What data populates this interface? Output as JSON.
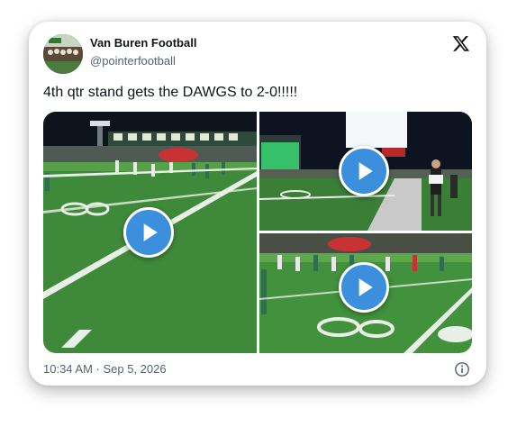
{
  "author": {
    "display_name": "Van Buren Football",
    "handle": "@pointerfootball",
    "avatar_icon": "team-photo-avatar"
  },
  "platform_icon": "x-logo-icon",
  "tweet": {
    "text": "4th qtr stand gets the DAWGS to 2-0!!!!!"
  },
  "media": {
    "count": 3,
    "items": [
      {
        "type": "video",
        "scene": "wide field view, night game"
      },
      {
        "type": "video",
        "scene": "stadium lights and referee"
      },
      {
        "type": "video",
        "scene": "line of scrimmage near 30-yard line"
      }
    ],
    "play_icon": "play-icon"
  },
  "footer": {
    "timestamp": "10:34 AM · Sep 5, 2026",
    "info_icon": "info-icon"
  },
  "colors": {
    "play_button": "#3b8fdc",
    "field_green": "#3f8a3a",
    "text_primary": "#0f1419",
    "text_secondary": "#536471"
  }
}
